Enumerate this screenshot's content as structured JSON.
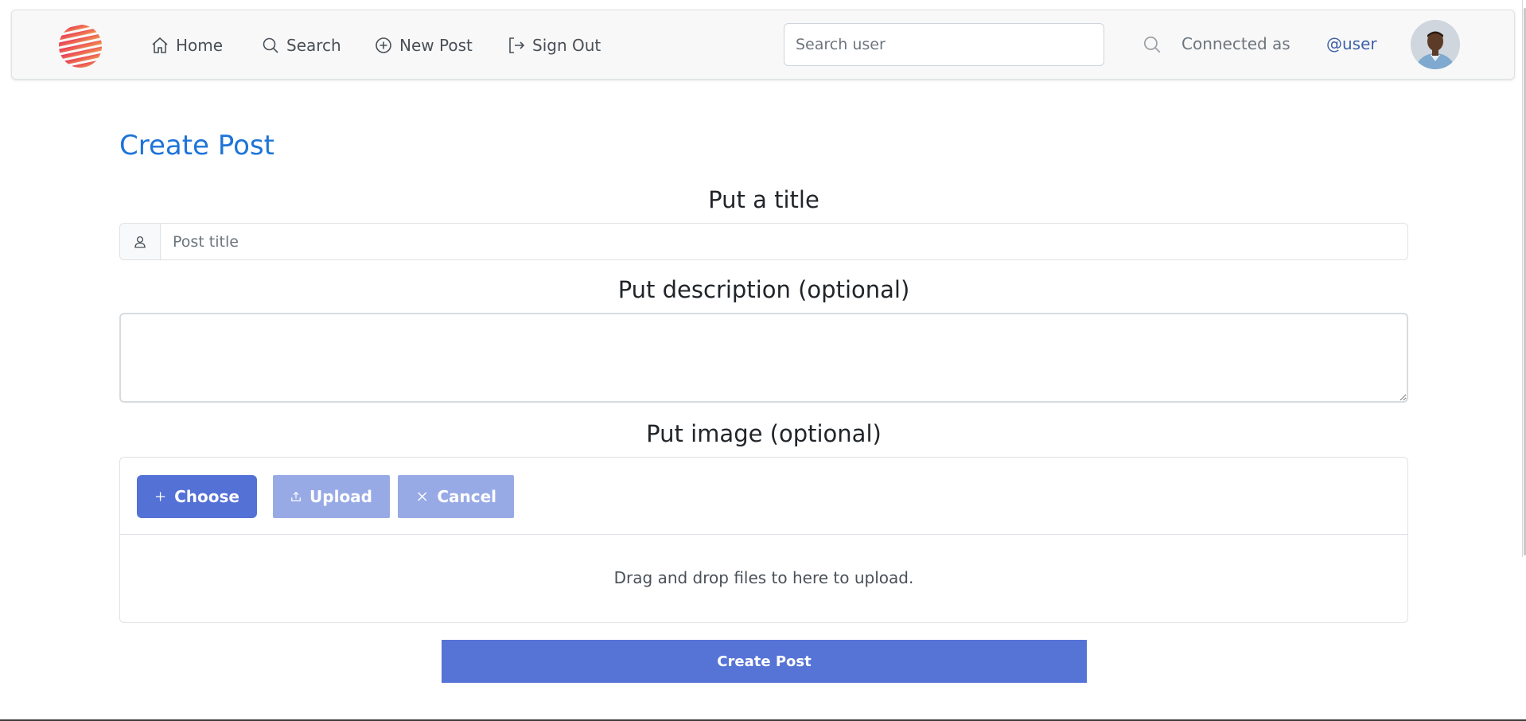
{
  "navbar": {
    "home_label": "Home",
    "search_label": "Search",
    "new_post_label": "New Post",
    "sign_out_label": "Sign Out",
    "search_user_placeholder": "Search user",
    "connected_as": "Connected as",
    "username": "@user"
  },
  "form": {
    "page_title": "Create Post",
    "title_label": "Put a title",
    "title_placeholder": "Post title",
    "description_label": "Put description (optional)",
    "description_value": "",
    "image_label": "Put image (optional)",
    "choose_label": "Choose",
    "upload_label": "Upload",
    "cancel_label": "Cancel",
    "dropzone_text": "Drag and drop files to here to upload.",
    "submit_label": "Create Post"
  },
  "colors": {
    "accent_blue": "#1e74d8",
    "primary_button": "#5471d6",
    "disabled_button": "#98aae6",
    "username_link": "#3f5fa8"
  },
  "icons": {
    "home": "home-icon",
    "search": "search-icon",
    "new_post": "plus-circle-icon",
    "sign_out": "sign-out-icon",
    "user": "user-icon",
    "plus": "plus-icon",
    "upload": "upload-icon",
    "cancel": "close-icon"
  }
}
